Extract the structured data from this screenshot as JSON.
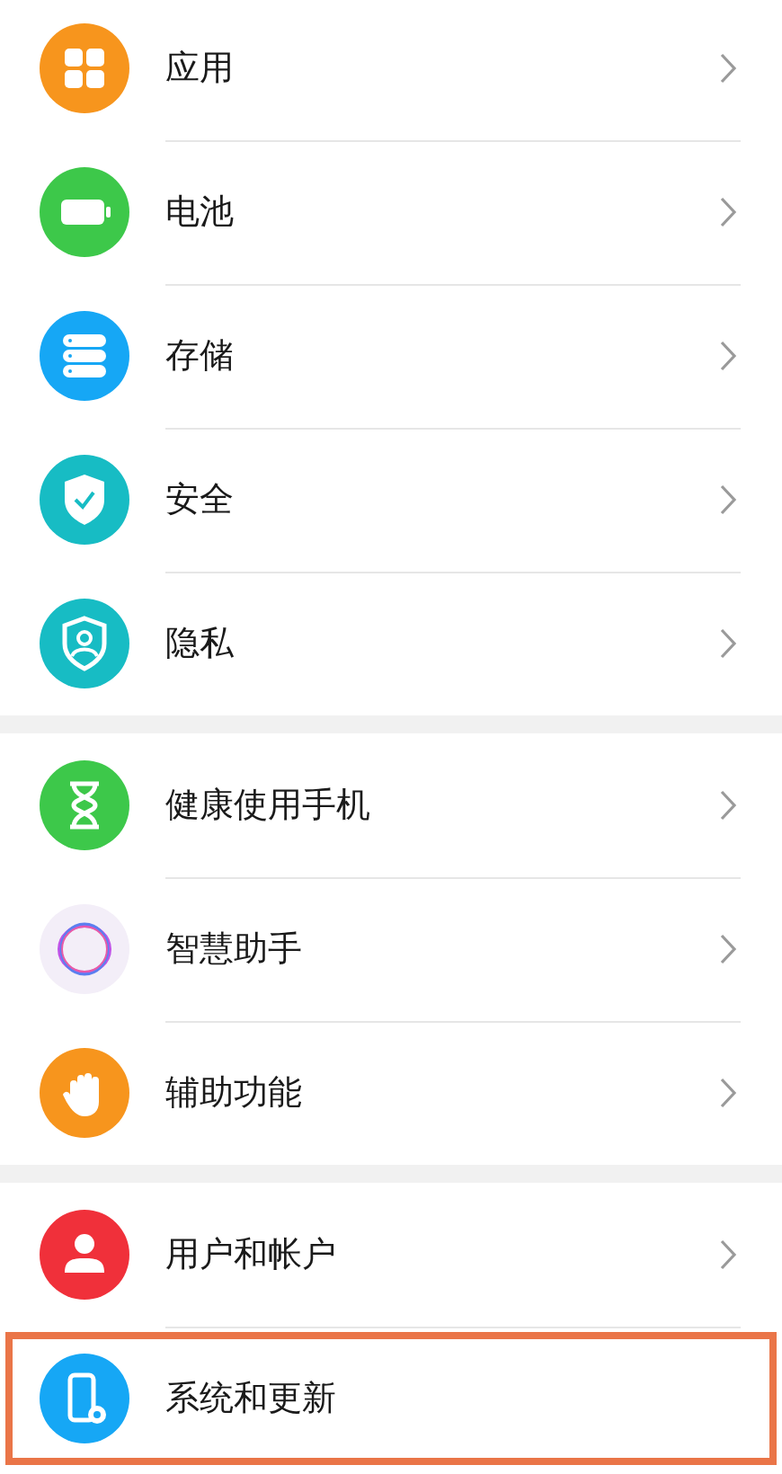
{
  "groups": [
    {
      "items": [
        {
          "label": "应用",
          "kind": "apps",
          "color": "#f7951d",
          "chevron": true,
          "highlighted": false
        },
        {
          "label": "电池",
          "kind": "battery",
          "color": "#3dc84a",
          "chevron": true,
          "highlighted": false
        },
        {
          "label": "存储",
          "kind": "storage",
          "color": "#16a7f5",
          "chevron": true,
          "highlighted": false
        },
        {
          "label": "安全",
          "kind": "security",
          "color": "#17bcc4",
          "chevron": true,
          "highlighted": false
        },
        {
          "label": "隐私",
          "kind": "privacy",
          "color": "#17bcc4",
          "chevron": true,
          "highlighted": false
        }
      ]
    },
    {
      "items": [
        {
          "label": "健康使用手机",
          "kind": "hourglass",
          "color": "#3dc84a",
          "chevron": true,
          "highlighted": false
        },
        {
          "label": "智慧助手",
          "kind": "assistant",
          "color": "#f3eef8",
          "chevron": true,
          "highlighted": false
        },
        {
          "label": "辅助功能",
          "kind": "hand",
          "color": "#f7951d",
          "chevron": true,
          "highlighted": false
        }
      ]
    },
    {
      "items": [
        {
          "label": "用户和帐户",
          "kind": "user",
          "color": "#f0303a",
          "chevron": true,
          "highlighted": false
        },
        {
          "label": "系统和更新",
          "kind": "system",
          "color": "#16a7f5",
          "chevron": false,
          "highlighted": true
        }
      ]
    }
  ]
}
